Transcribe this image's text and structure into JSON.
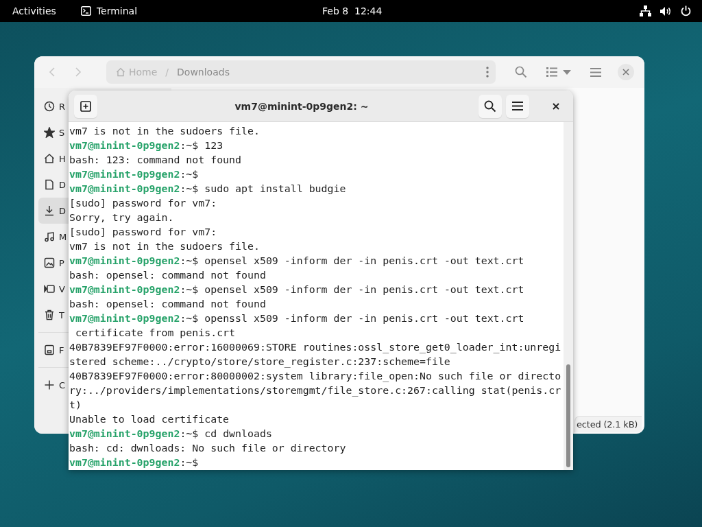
{
  "top_bar": {
    "activities": "Activities",
    "app": "Terminal",
    "clock": "Feb 8  12:44"
  },
  "file_manager": {
    "nav": [
      {
        "kind": "back",
        "disabled": true
      },
      {
        "kind": "forward",
        "disabled": true
      }
    ],
    "path": [
      {
        "label": "Home",
        "kind": "home"
      },
      {
        "separator": "/",
        "label": "Downloads",
        "kind": "folder"
      }
    ],
    "sidebar": [
      {
        "label": "R",
        "selected": false
      },
      {
        "label": "S",
        "selected": false
      },
      {
        "label": "H",
        "selected": false
      },
      {
        "label": "D",
        "selected": false
      },
      {
        "label": "D",
        "selected": true
      },
      {
        "label": "M",
        "selected": false
      },
      {
        "label": "P",
        "selected": false
      },
      {
        "label": "V",
        "selected": false
      },
      {
        "label": "T",
        "selected": false
      },
      {
        "label": "F",
        "selected": false
      },
      {
        "label": "C",
        "selected": false
      }
    ],
    "status": "ected (2.1 kB)"
  },
  "terminal": {
    "title": "vm7@minint-0p9gen2: ~",
    "lines": [
      {
        "kind": "output",
        "text": "vm7 is not in the sudoers file."
      },
      {
        "kind": "prompt",
        "user": "vm7@minint-0p9gen2",
        "path": ":~$",
        "command": "123"
      },
      {
        "kind": "output",
        "text": "bash: 123: command not found"
      },
      {
        "kind": "prompt",
        "user": "vm7@minint-0p9gen2",
        "path": ":~$"
      },
      {
        "kind": "prompt",
        "user": "vm7@minint-0p9gen2",
        "path": ":~$",
        "command": "sudo apt install budgie"
      },
      {
        "kind": "output",
        "text": "[sudo] password for vm7:"
      },
      {
        "kind": "output",
        "text": "Sorry, try again."
      },
      {
        "kind": "output",
        "text": "[sudo] password for vm7:"
      },
      {
        "kind": "output",
        "text": "vm7 is not in the sudoers file."
      },
      {
        "kind": "prompt",
        "user": "vm7@minint-0p9gen2",
        "path": ":~$",
        "command": "opensel x509 -inform der -in penis.crt -out text.crt"
      },
      {
        "kind": "output",
        "text": "bash: opensel: command not found"
      },
      {
        "kind": "prompt",
        "user": "vm7@minint-0p9gen2",
        "path": ":~$",
        "command": "opensel x509 -inform der -in penis.crt -out text.crt"
      },
      {
        "kind": "output",
        "text": "bash: opensel: command not found"
      },
      {
        "kind": "prompt",
        "user": "vm7@minint-0p9gen2",
        "path": ":~$",
        "command": "openssl x509 -inform der -in penis.crt -out text.crt"
      },
      {
        "kind": "output",
        "text": " certificate from penis.crt"
      },
      {
        "kind": "output",
        "text": "40B7839EF97F0000:error:16000069:STORE routines:ossl_store_get0_loader_int:unregi"
      },
      {
        "kind": "output",
        "text": "stered scheme:../crypto/store/store_register.c:237:scheme=file"
      },
      {
        "kind": "output",
        "text": "40B7839EF97F0000:error:80000002:system library:file_open:No such file or directo"
      },
      {
        "kind": "output",
        "text": "ry:../providers/implementations/storemgmt/file_store.c:267:calling stat(penis.cr"
      },
      {
        "kind": "output",
        "text": "t)"
      },
      {
        "kind": "output",
        "text": "Unable to load certificate"
      },
      {
        "kind": "prompt",
        "user": "vm7@minint-0p9gen2",
        "path": ":~$",
        "command": "cd dwnloads"
      },
      {
        "kind": "output",
        "text": "bash: cd: dwnloads: No such file or directory"
      },
      {
        "kind": "prompt",
        "user": "vm7@minint-0p9gen2",
        "path": ":~$"
      }
    ]
  }
}
